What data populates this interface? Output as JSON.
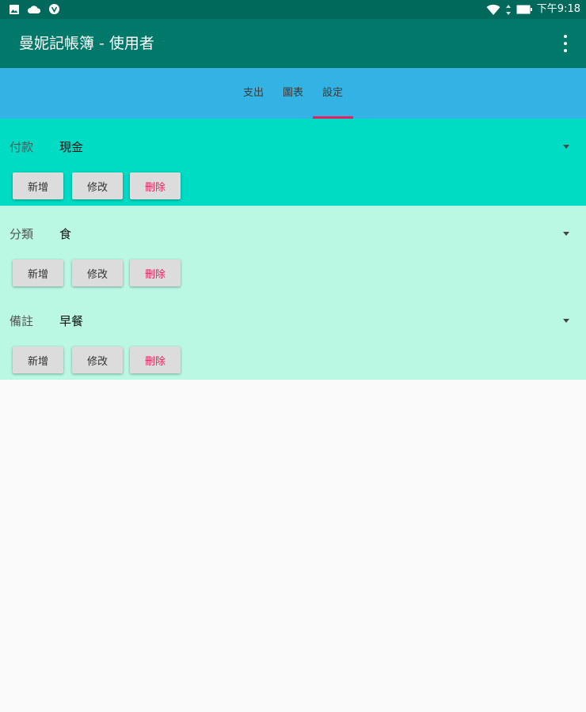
{
  "status_bar": {
    "left_icons": [
      "image-icon",
      "cloud-icon",
      "vpn-icon"
    ],
    "right_icons": [
      "wifi-icon",
      "signal-arrows-icon",
      "battery-icon"
    ],
    "time": "下午9:18"
  },
  "app_bar": {
    "title": "曼妮記帳簿 - 使用者",
    "menu_icon": "more-vert-icon"
  },
  "tabs": [
    {
      "label": "支出"
    },
    {
      "label": "圖表"
    },
    {
      "label": "設定",
      "selected": true
    }
  ],
  "settings": {
    "payment": {
      "label": "付款",
      "value": "現金",
      "buttons": {
        "add": "新增",
        "edit": "修改",
        "delete": "刪除"
      }
    },
    "category": {
      "label": "分類",
      "value": "食",
      "buttons": {
        "add": "新增",
        "edit": "修改",
        "delete": "刪除"
      }
    },
    "note": {
      "label": "備註",
      "value": "早餐",
      "buttons": {
        "add": "新增",
        "edit": "修改",
        "delete": "刪除"
      }
    }
  },
  "colors": {
    "status_bar": "#00695c",
    "app_bar": "#00796b",
    "tab_bar": "#33b3e4",
    "tab_indicator": "#e91e63",
    "payment_section": "#00dbc4",
    "lower_section": "#baf8e4",
    "delete_text": "#e0245e"
  }
}
